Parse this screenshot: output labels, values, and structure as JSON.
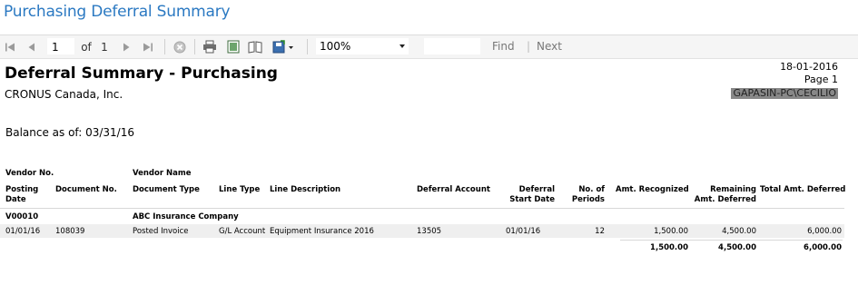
{
  "window": {
    "title": "Purchasing Deferral Summary"
  },
  "toolbar": {
    "page_current": "1",
    "page_of_label": "of",
    "page_total": "1",
    "zoom": "100%",
    "find_label": "Find",
    "next_label": "Next",
    "separator": "|"
  },
  "report": {
    "title": "Deferral Summary - Purchasing",
    "company": "CRONUS Canada, Inc.",
    "date": "18-01-2016",
    "page": "Page 1",
    "user": "GAPASIN-PC\\CECILIO",
    "balance_label": "Balance as of: 03/31/16"
  },
  "table": {
    "headers": {
      "vendor_no": "Vendor No.",
      "vendor_name": "Vendor Name",
      "posting_date": "Posting Date",
      "document_no": "Document No.",
      "document_type": "Document Type",
      "line_type": "Line Type",
      "line_description": "Line Description",
      "deferral_account": "Deferral Account",
      "deferral_start_date": "Deferral Start Date",
      "no_of_periods": "No. of Periods",
      "amt_recognized": "Amt. Recognized",
      "remaining_amt_deferred": "Remaining Amt. Deferred",
      "total_amt_deferred": "Total Amt. Deferred"
    },
    "vendor": {
      "no": "V00010",
      "name": "ABC Insurance Company"
    },
    "row": {
      "posting_date": "01/01/16",
      "document_no": "108039",
      "document_type": "Posted Invoice",
      "line_type": "G/L Account",
      "line_description": "Equipment Insurance 2016",
      "deferral_account": "13505",
      "deferral_start_date": "01/01/16",
      "no_of_periods": "12",
      "amt_recognized": "1,500.00",
      "remaining_amt_deferred": "4,500.00",
      "total_amt_deferred": "6,000.00"
    },
    "totals": {
      "amt_recognized": "1,500.00",
      "remaining_amt_deferred": "4,500.00",
      "total_amt_deferred": "6,000.00"
    }
  },
  "colors": {
    "title_blue": "#2b79c2",
    "toolbar_bg": "#f5f5f5",
    "user_highlight": "#888888"
  }
}
